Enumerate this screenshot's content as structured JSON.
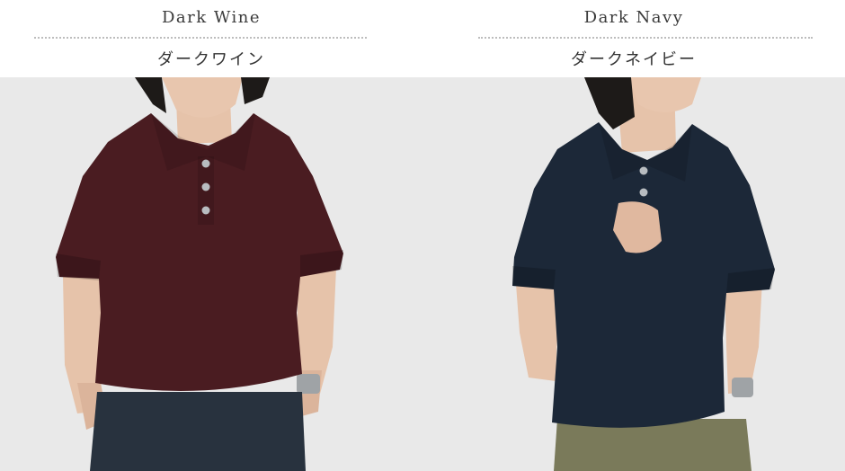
{
  "variants": [
    {
      "name_en": "Dark Wine",
      "name_jp": "ダークワイン",
      "shirt_color": "#4a1c21"
    },
    {
      "name_en": "Dark Navy",
      "name_jp": "ダークネイビー",
      "shirt_color": "#1c2838"
    }
  ],
  "colors": {
    "background": "#e9e9e9",
    "skin": "#e6c3aa",
    "hair": "#1d1a18",
    "pants_left": "#28323e",
    "pants_right": "#7a7a5a",
    "button": "#b8bcc0"
  }
}
